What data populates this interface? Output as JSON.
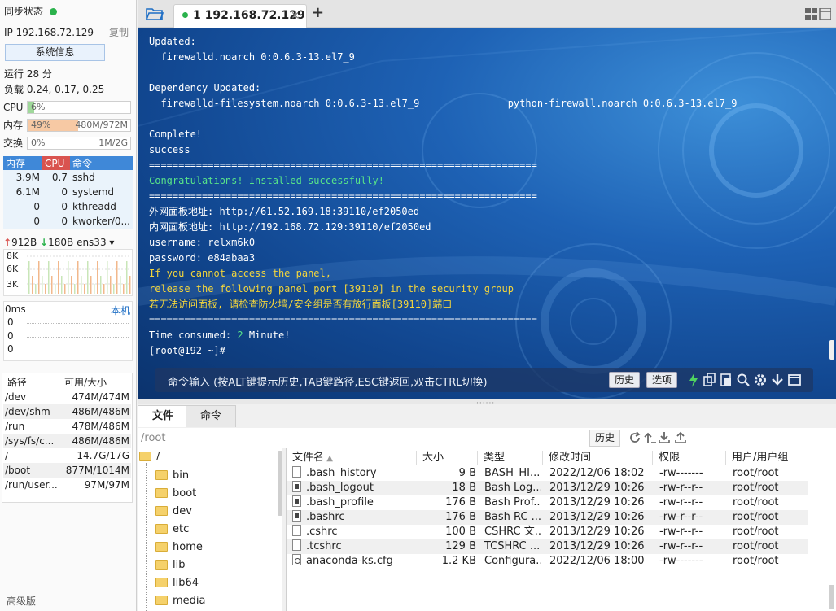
{
  "sidebar": {
    "sync_status": "同步状态",
    "ip": "IP 192.168.72.129",
    "copy": "复制",
    "system_info_button": "系统信息",
    "uptime": "运行 28 分",
    "load": "负载 0.24, 0.17, 0.25",
    "cpu": {
      "label": "CPU",
      "percent": "6%",
      "value": "",
      "fraction": 0.06,
      "color": "#9fd89a"
    },
    "memory": {
      "label": "内存",
      "percent": "49%",
      "value": "480M/972M",
      "fraction": 0.49,
      "color": "#f7c9a4"
    },
    "swap": {
      "label": "交换",
      "percent": "0%",
      "value": "1M/2G",
      "fraction": 0.0,
      "color": "#9fd89a"
    },
    "process_table": {
      "headers": [
        "内存",
        "CPU",
        "命令"
      ],
      "rows": [
        {
          "mem": "3.9M",
          "cpu": "0.7",
          "cmd": "sshd"
        },
        {
          "mem": "6.1M",
          "cpu": "0",
          "cmd": "systemd"
        },
        {
          "mem": "0",
          "cpu": "0",
          "cmd": "kthreadd"
        },
        {
          "mem": "0",
          "cpu": "0",
          "cmd": "kworker/0..."
        }
      ]
    },
    "network": {
      "up": "912B",
      "down": "180B",
      "interface": "ens33",
      "y_ticks": [
        "8K",
        "6K",
        "3K"
      ]
    },
    "ping": {
      "latency": "0ms",
      "host": "本机",
      "values": [
        "0",
        "0",
        "0"
      ]
    },
    "disks": {
      "headers": [
        "路径",
        "可用/大小"
      ],
      "rows": [
        {
          "path": "/dev",
          "size": "474M/474M"
        },
        {
          "path": "/dev/shm",
          "size": "486M/486M"
        },
        {
          "path": "/run",
          "size": "478M/486M"
        },
        {
          "path": "/sys/fs/c...",
          "size": "486M/486M"
        },
        {
          "path": "/",
          "size": "14.7G/17G"
        },
        {
          "path": "/boot",
          "size": "877M/1014M"
        },
        {
          "path": "/run/user...",
          "size": "97M/97M"
        }
      ]
    },
    "advanced": "高级版"
  },
  "tabs": {
    "session_tab": "1 192.168.72.129",
    "close": "×",
    "add": "+"
  },
  "terminal": {
    "lines": [
      {
        "text": "Updated:",
        "color": "white"
      },
      {
        "text": "  firewalld.noarch 0:0.6.3-13.el7_9",
        "color": "white"
      },
      {
        "text": "",
        "color": "white"
      },
      {
        "text": "Dependency Updated:",
        "color": "white"
      },
      {
        "text": "  firewalld-filesystem.noarch 0:0.6.3-13.el7_9               python-firewall.noarch 0:0.6.3-13.el7_9",
        "color": "white"
      },
      {
        "text": "",
        "color": "white"
      },
      {
        "text": "Complete!",
        "color": "white"
      },
      {
        "text": "success",
        "color": "white"
      },
      {
        "text": "==================================================================",
        "color": "white"
      },
      {
        "text": "Congratulations! Installed successfully!",
        "color": "green"
      },
      {
        "text": "==================================================================",
        "color": "white"
      },
      {
        "text": "外网面板地址: http://61.52.169.18:39110/ef2050ed",
        "color": "white"
      },
      {
        "text": "内网面板地址: http://192.168.72.129:39110/ef2050ed",
        "color": "white"
      },
      {
        "text": "username: relxm6k0",
        "color": "white"
      },
      {
        "text": "password: e84abaa3",
        "color": "white"
      },
      {
        "text": "If you cannot access the panel,",
        "color": "yellow"
      },
      {
        "text": "release the following panel port [39110] in the security group",
        "color": "yellow"
      },
      {
        "text": "若无法访问面板, 请检查防火墙/安全组是否有放行面板[39110]端口",
        "color": "yellow"
      },
      {
        "text": "==================================================================",
        "color": "white"
      },
      {
        "text": "Time consumed: 2 Minute!",
        "color": "white",
        "highlight": "2"
      },
      {
        "text": "[root@192 ~]#",
        "color": "white"
      }
    ],
    "command_placeholder": "命令输入 (按ALT键提示历史,TAB键路径,ESC键返回,双击CTRL切换)",
    "history_button": "历史",
    "options_button": "选项"
  },
  "bottom": {
    "tab_files": "文件",
    "tab_commands": "命令",
    "path": "/root",
    "history_button": "历史"
  },
  "tree": {
    "root": "/",
    "items": [
      "bin",
      "boot",
      "dev",
      "etc",
      "home",
      "lib",
      "lib64",
      "media"
    ]
  },
  "files": {
    "headers": [
      "文件名",
      "大小",
      "类型",
      "修改时间",
      "权限",
      "用户/用户组"
    ],
    "rows": [
      {
        "name": ".bash_history",
        "size": "9 B",
        "type": "BASH_HI...",
        "mtime": "2022/12/06 18:02",
        "perm": "-rw-------",
        "owner": "root/root",
        "icon": "plain"
      },
      {
        "name": ".bash_logout",
        "size": "18 B",
        "type": "Bash Log...",
        "mtime": "2013/12/29 10:26",
        "perm": "-rw-r--r--",
        "owner": "root/root",
        "icon": "dark"
      },
      {
        "name": ".bash_profile",
        "size": "176 B",
        "type": "Bash Prof...",
        "mtime": "2013/12/29 10:26",
        "perm": "-rw-r--r--",
        "owner": "root/root",
        "icon": "dark"
      },
      {
        "name": ".bashrc",
        "size": "176 B",
        "type": "Bash RC ...",
        "mtime": "2013/12/29 10:26",
        "perm": "-rw-r--r--",
        "owner": "root/root",
        "icon": "dark"
      },
      {
        "name": ".cshrc",
        "size": "100 B",
        "type": "CSHRC 文...",
        "mtime": "2013/12/29 10:26",
        "perm": "-rw-r--r--",
        "owner": "root/root",
        "icon": "plain"
      },
      {
        "name": ".tcshrc",
        "size": "129 B",
        "type": "TCSHRC ...",
        "mtime": "2013/12/29 10:26",
        "perm": "-rw-r--r--",
        "owner": "root/root",
        "icon": "plain"
      },
      {
        "name": "anaconda-ks.cfg",
        "size": "1.2 KB",
        "type": "Configura...",
        "mtime": "2022/12/06 18:00",
        "perm": "-rw-------",
        "owner": "root/root",
        "icon": "cfg"
      }
    ]
  }
}
